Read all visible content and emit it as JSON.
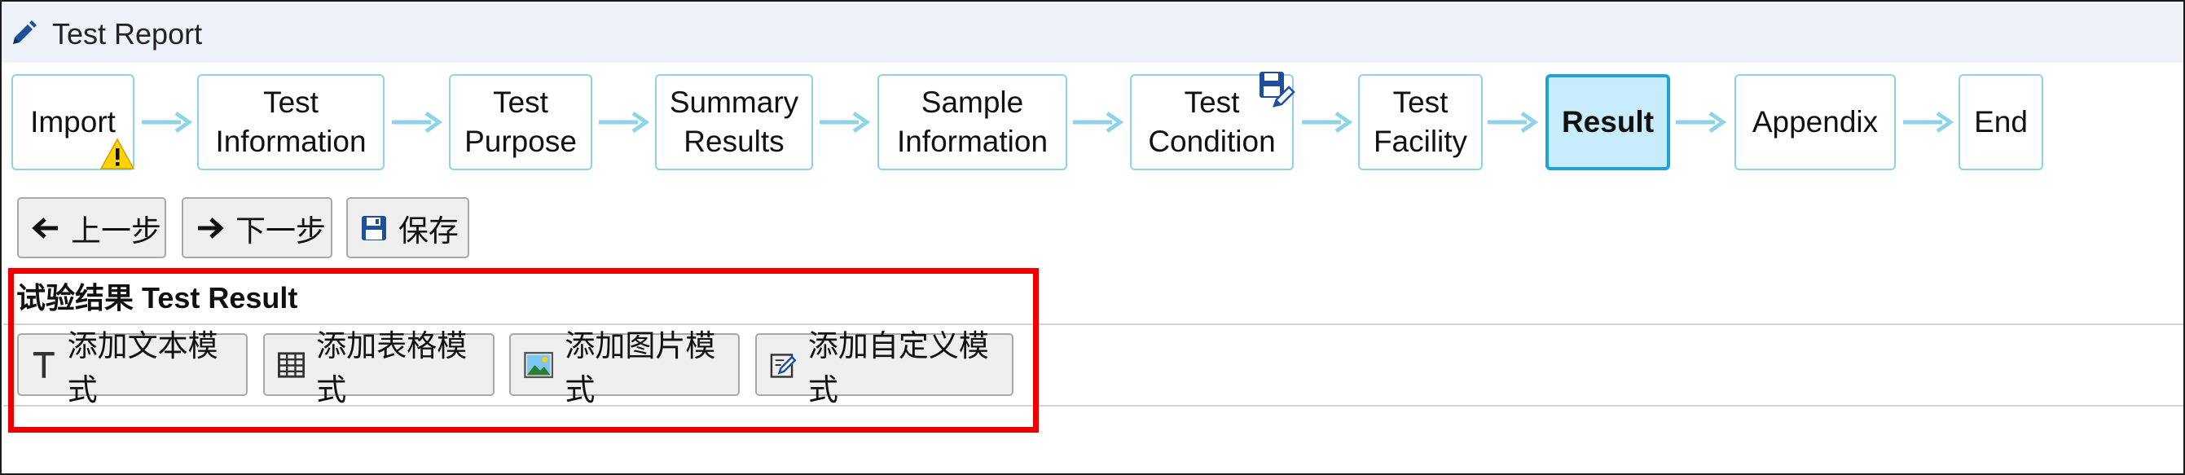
{
  "window": {
    "title": "Test Report",
    "title_icon": "pencil-icon"
  },
  "steps": [
    {
      "label": "Import",
      "badge": "warning-icon"
    },
    {
      "label": "Test\nInformation"
    },
    {
      "label": "Test\nPurpose"
    },
    {
      "label": "Summary\nResults"
    },
    {
      "label": "Sample\nInformation"
    },
    {
      "label": "Test\nCondition",
      "badge": "save-edit-icon"
    },
    {
      "label": "Test\nFacility"
    },
    {
      "label": "Result",
      "active": true
    },
    {
      "label": "Appendix"
    },
    {
      "label": "End"
    }
  ],
  "toolbar": {
    "prev_label": "上一步",
    "next_label": "下一步",
    "save_label": "保存"
  },
  "section": {
    "title": "试验结果 Test Result",
    "buttons": [
      {
        "label": "添加文本模式",
        "icon": "text-icon"
      },
      {
        "label": "添加表格模式",
        "icon": "table-icon"
      },
      {
        "label": "添加图片模式",
        "icon": "image-icon"
      },
      {
        "label": "添加自定义模式",
        "icon": "custom-edit-icon"
      }
    ]
  },
  "colors": {
    "step_border": "#8fd3e8",
    "active_fill": "#c8ecfb",
    "active_border": "#1ea1dc",
    "arrow": "#8fd3e8",
    "highlight": "#ee0000",
    "warning": "#ffd200",
    "titlebar": "#eef3f9"
  }
}
